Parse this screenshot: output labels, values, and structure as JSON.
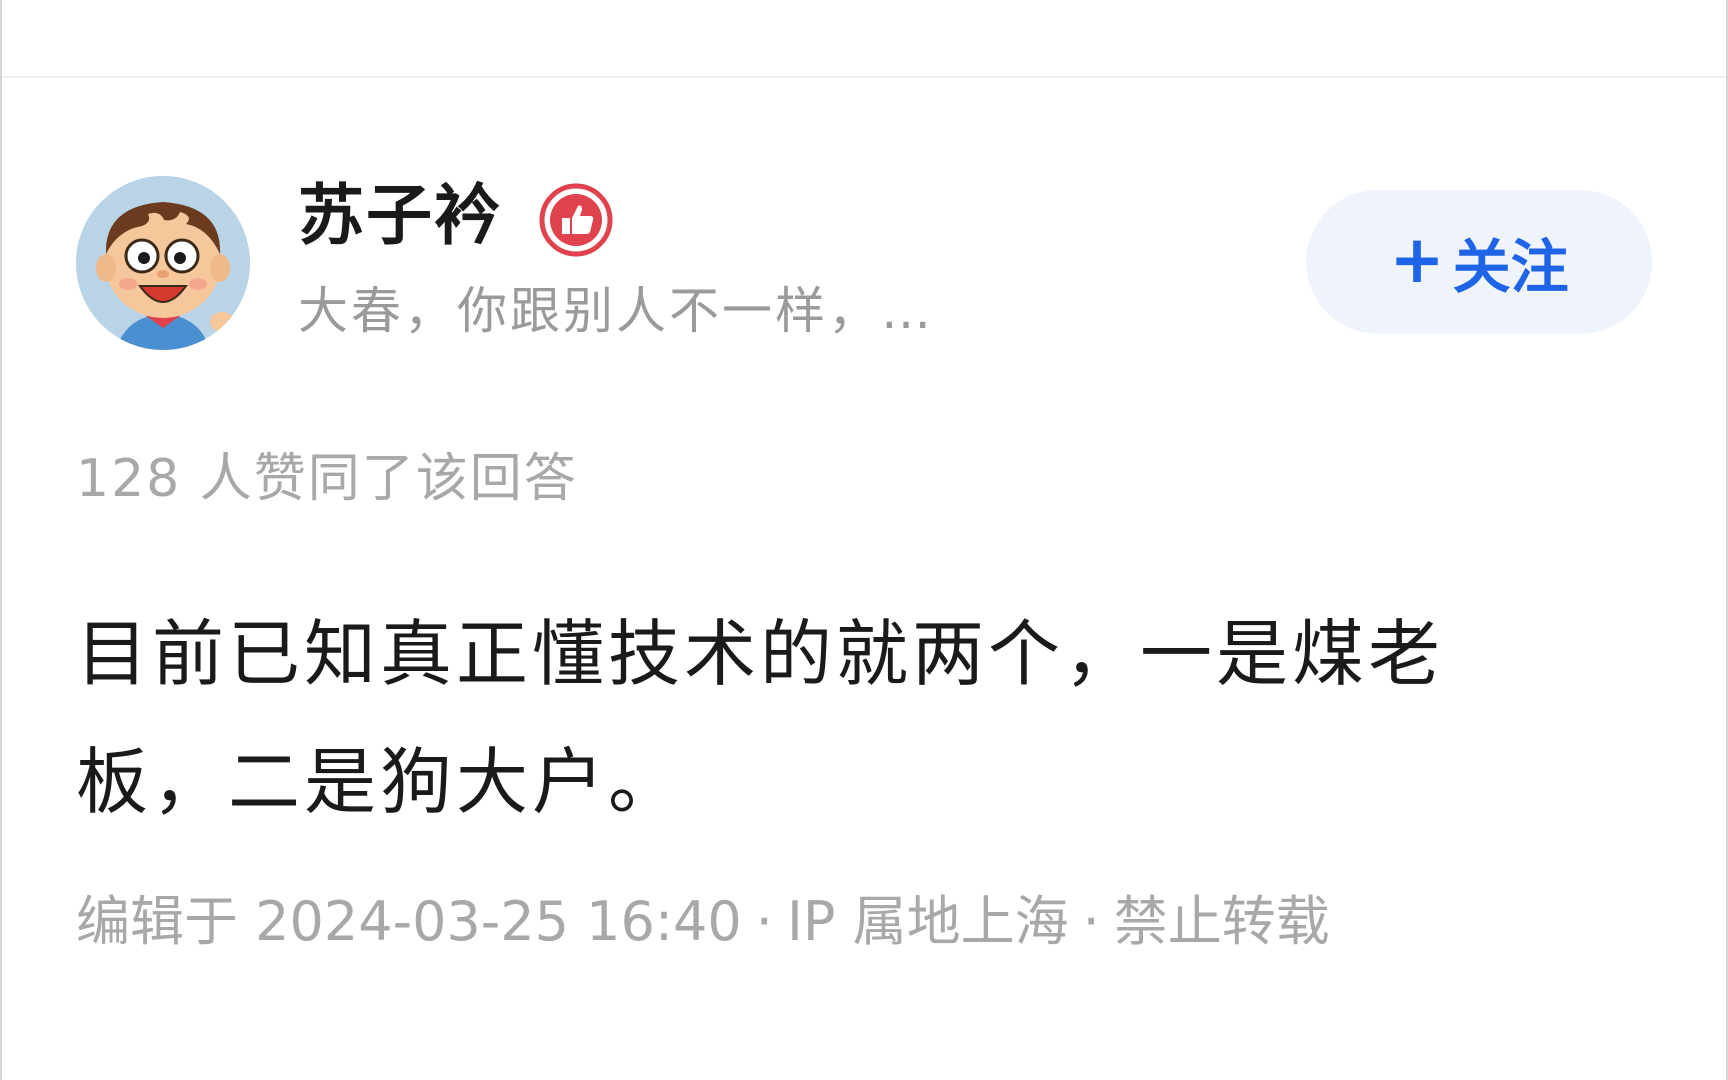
{
  "author": {
    "name": "苏子衿",
    "badge_icon": "thumbs-up-badge-icon",
    "headline": "大春，你跟别人不一样，…",
    "avatar_icon": "cartoon-boy-avatar-icon"
  },
  "follow": {
    "plus": "+",
    "label": "关注"
  },
  "votes": {
    "text": "128 人赞同了该回答"
  },
  "answer": {
    "text": "目前已知真正懂技术的就两个，一是煤老板，二是狗大户。"
  },
  "meta": {
    "edited": "编辑于 2024-03-25 16:40",
    "separator": "·",
    "ip": "IP 属地上海",
    "copyright": "禁止转载"
  },
  "colors": {
    "accent": "#1f64e6",
    "follow_bg": "#eef3fc",
    "muted_text": "#a8a8a8",
    "badge_red": "#e0424e"
  }
}
